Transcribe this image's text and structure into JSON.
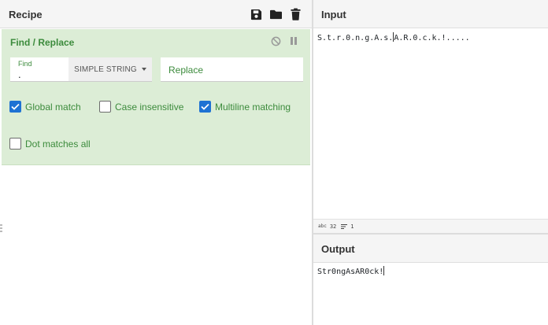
{
  "recipe": {
    "title": "Recipe",
    "icons": [
      "save-icon",
      "folder-icon",
      "trash-icon"
    ]
  },
  "operation": {
    "title": "Find / Replace",
    "find_label": "Find",
    "find_value": ".",
    "find_type": "SIMPLE STRING",
    "replace_placeholder": "Replace",
    "options": [
      {
        "label": "Global match",
        "checked": true
      },
      {
        "label": "Case insensitive",
        "checked": false
      },
      {
        "label": "Multiline matching",
        "checked": true
      },
      {
        "label": "Dot matches all",
        "checked": false
      }
    ],
    "icons": [
      "disable-icon",
      "pause-icon"
    ]
  },
  "input": {
    "title": "Input",
    "text_before_cursor": "S.t.r.0.n.g.A.s.",
    "text_after_cursor": "A.R.0.c.k.!.....",
    "stats": {
      "length": "32",
      "lines": "1"
    }
  },
  "output": {
    "title": "Output",
    "text": "Str0ngAsAR0ck!"
  },
  "colors": {
    "accent_green": "#3c8b3c",
    "operation_bg": "#dcedd6",
    "checkbox_blue": "#1e72d3"
  }
}
